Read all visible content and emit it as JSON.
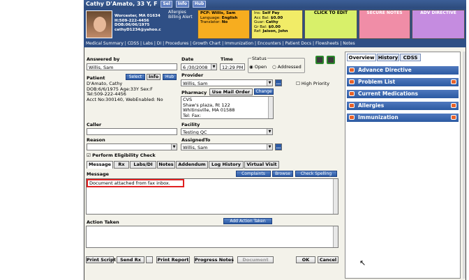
{
  "titlebar": {
    "patient": "Cathy D'Amato, 33 Y, F",
    "btns": [
      "Sel",
      "Info",
      "Hub"
    ]
  },
  "header": {
    "address": "Worcester, MA 01634",
    "phone": "H:509-222-4456",
    "dob": "DOB:06/06/1975",
    "email": "cathyD1234@yahoo.c",
    "allergies": "Allergies",
    "billing": "Billing Alert",
    "pcp": {
      "line1": "PCP:",
      "pcp_val": "Willis, Sam",
      "lang": "Language:",
      "lang_val": "English",
      "trans": "Translator:",
      "trans_val": "No"
    },
    "ins": {
      "l1": "Ins:",
      "v1": "Self Pay",
      "l2": "Acc Bal:",
      "v2": "$0.00",
      "l3": "Guar:",
      "v3": "Cathy",
      "l4": "Gr Bal:",
      "v4": "$0.00",
      "l5": "Ref:",
      "v5": "Jaison, John"
    },
    "click_to_edit": "CLICK TO EDIT",
    "secure_notes": "SECURE NOTES",
    "adv_directive": "ADV DIRECTIVE"
  },
  "menu": "Medical Summary | CDSS | Labs | DI | Procedures | Growth Chart | Immunization | Encounters | Patient Docs | Flowsheets | Notes",
  "form": {
    "answered_by_label": "Answered by",
    "answered_by": "Willis, Sam",
    "date_label": "Date",
    "date": "6 /30/2008",
    "time_label": "Time",
    "time": "12:29 PM",
    "status_label": "Status",
    "status_open": "Open",
    "status_addressed": "Addressed",
    "patient_label": "Patient",
    "select_btn": "Select",
    "info_btn": "Info",
    "hub_btn": "Hub",
    "patient_lines": [
      "D'Amato, Cathy",
      "DOB:6/6/1975  Age:33Y  Sex:F",
      "Tel:509-222-4456",
      "Acct No:300140, WebEnabled: No"
    ],
    "provider_label": "Provider",
    "provider": "Willis, Sam",
    "high_priority": "High Priority",
    "pharmacy_label": "Pharmacy",
    "use_mail_order": "Use Mail Order",
    "change_btn": "Change",
    "pharmacy_lines": [
      "CVS",
      "Shaw's plaza, Rt 122",
      "Whitinsville, MA 01588",
      "Tel: Fax:"
    ],
    "caller_label": "Caller",
    "caller": "",
    "facility_label": "Facility",
    "facility": "Testing QC",
    "reason_label": "Reason",
    "reason": "",
    "assigned_to_label": "AssignedTo",
    "assigned_to": "Willis, Sam",
    "eligibility": "Perform Eligibility Check",
    "tabs": [
      "Message",
      "Rx",
      "Labs/DI",
      "Notes",
      "Addendum",
      "Log History",
      "Virtual Visit"
    ],
    "message_label": "Message",
    "complaints_btn": "Complaints",
    "browse_btn": "Browse",
    "spell_btn": "Check Spelling",
    "message_text": "Document attached from fax inbox.",
    "action_taken_label": "Action Taken",
    "add_action_btn": "Add Action Taken"
  },
  "footer": {
    "print_script": "Print Script",
    "send_rx": "Send Rx",
    "print_report": "Print Report",
    "progress_notes": "Progress Notes",
    "document": "Document",
    "ok": "OK",
    "cancel": "Cancel"
  },
  "right": {
    "tabs": [
      "Overview",
      "History",
      "CDSS"
    ],
    "rows": [
      "Advance Directive",
      "Problem List",
      "Current Medications",
      "Allergies",
      "Immunization"
    ]
  }
}
